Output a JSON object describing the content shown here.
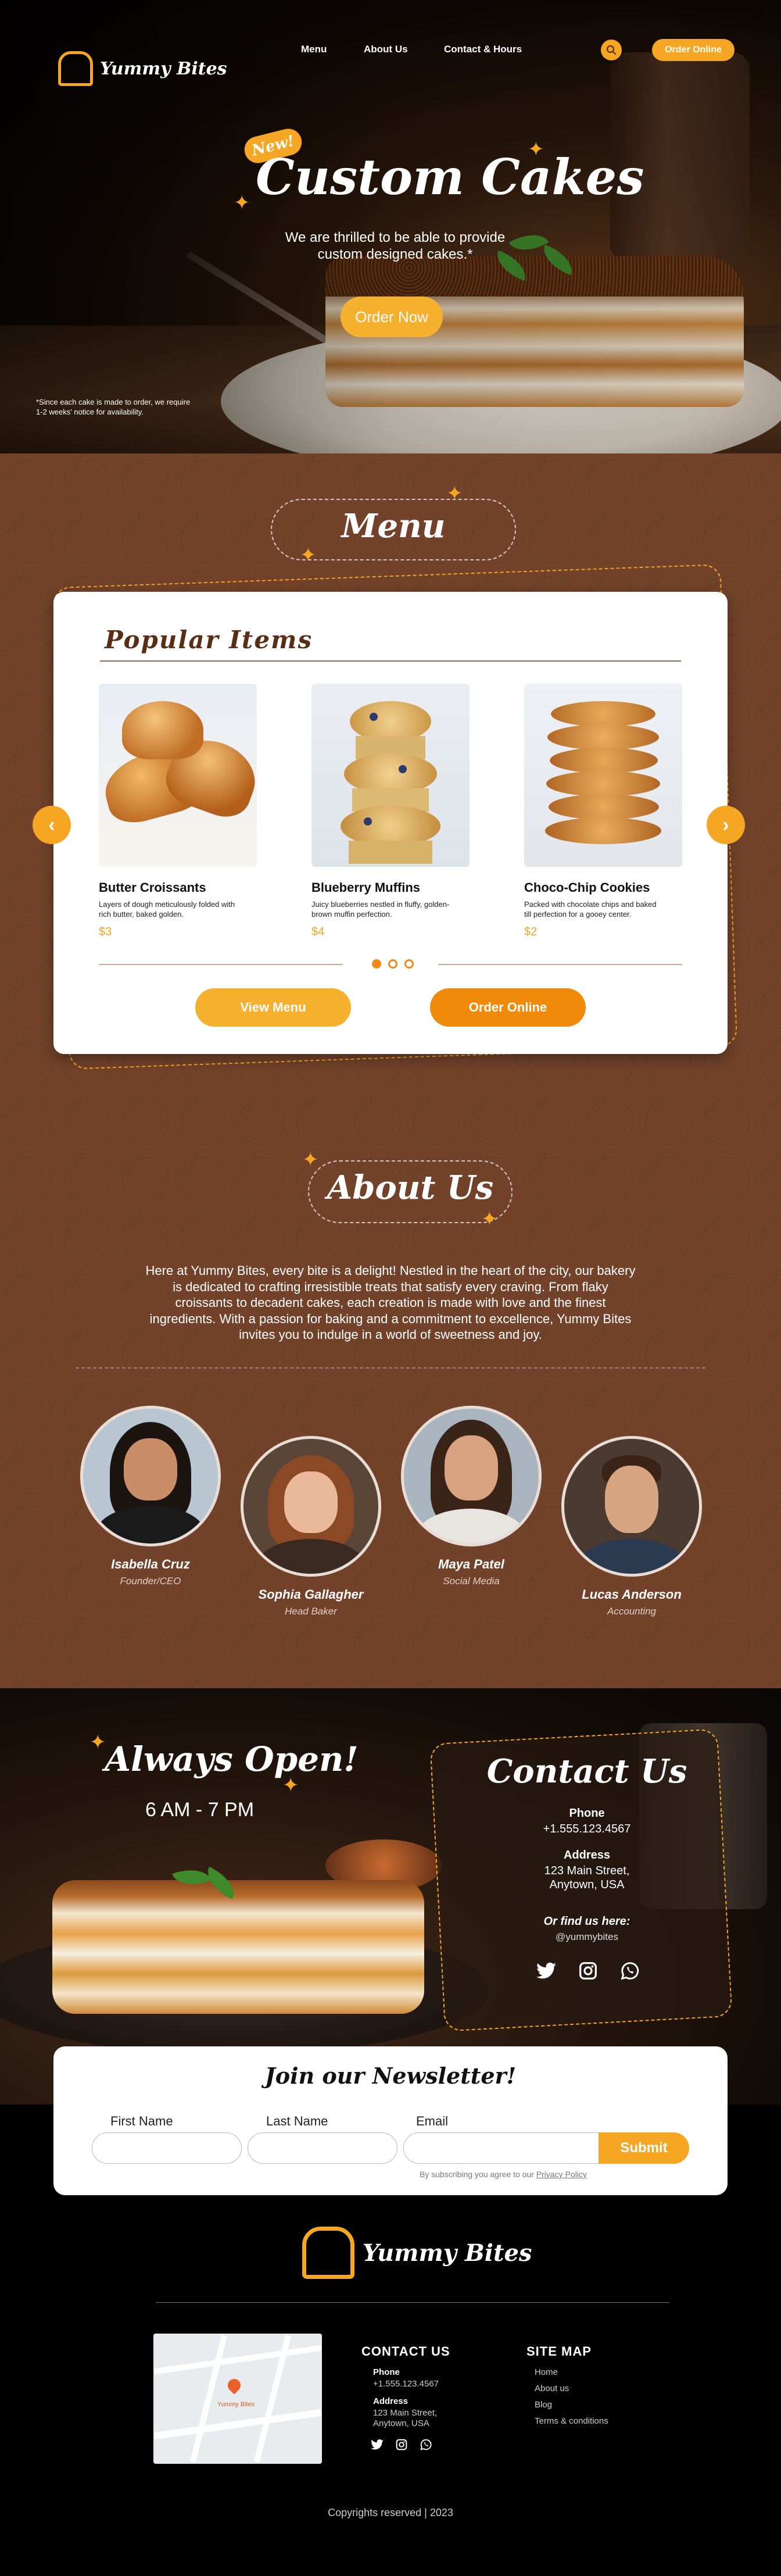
{
  "brand": {
    "name": "Yummy Bites",
    "accent": "#f5a623",
    "brown": "#72422a"
  },
  "nav": {
    "items": [
      "Menu",
      "About Us",
      "Contact & Hours"
    ],
    "order_online": "Order Online"
  },
  "hero": {
    "badge": "New!",
    "title": "Custom Cakes",
    "subtitle": "We are thrilled to be able to provide custom designed cakes.*",
    "cta": "Order Now",
    "note": "*Since each cake is made to order, we require 1-2 weeks' notice for availability."
  },
  "menu": {
    "title": "Menu",
    "card_title": "Popular Items",
    "items": [
      {
        "name": "Butter Croissants",
        "desc": "Layers of dough meticulously folded with rich butter, baked golden.",
        "price": "$3",
        "image": "croissants"
      },
      {
        "name": "Blueberry Muffins",
        "desc": "Juicy blueberries nestled in fluffy, golden-brown muffin perfection.",
        "price": "$4",
        "image": "blueberry-muffins"
      },
      {
        "name": "Choco-Chip Cookies",
        "desc": "Packed with chocolate chips and baked till perfection for a gooey center.",
        "price": "$2",
        "image": "chocolate-chip-cookies"
      }
    ],
    "view_menu": "View Menu",
    "order_online": "Order Online",
    "active_slide": 1
  },
  "about": {
    "title": "About Us",
    "text": "Here at Yummy Bites, every bite is a delight! Nestled in the heart of the city, our bakery is dedicated to crafting irresistible treats that satisfy every craving. From flaky croissants to decadent cakes, each creation is made with love and the finest ingredients. With a passion for baking and a commitment to excellence, Yummy Bites invites you to indulge in a world of sweetness and joy.",
    "team": [
      {
        "name": "Isabella Cruz",
        "role": "Founder/CEO"
      },
      {
        "name": "Sophia Gallagher",
        "role": "Head Baker"
      },
      {
        "name": "Maya Patel",
        "role": "Social Media"
      },
      {
        "name": "Lucas Anderson",
        "role": "Accounting"
      }
    ]
  },
  "hours": {
    "title": "Always Open!",
    "time": "6 AM - 7 PM"
  },
  "contact": {
    "title": "Contact Us",
    "phone_label": "Phone",
    "phone": "+1.555.123.4567",
    "address_label": "Address",
    "address_line1": "123 Main Street,",
    "address_line2": "Anytown, USA",
    "find_label": "Or find us here:",
    "handle": "@yummybites"
  },
  "newsletter": {
    "title": "Join our Newsletter!",
    "first_name": "First Name",
    "last_name": "Last Name",
    "email": "Email",
    "submit": "Submit",
    "note_prefix": "By subscribing you agree to our ",
    "privacy": "Privacy Policy"
  },
  "footer": {
    "contact_title": "CONTACT US",
    "phone_label": "Phone",
    "phone": "+1.555.123.4567",
    "address_label": "Address",
    "address_line1": "123 Main Street,",
    "address_line2": "Anytown, USA",
    "sitemap_title": "SITE MAP",
    "links": [
      "Home",
      "About us",
      "Blog",
      "Terms & conditions"
    ],
    "map_labels": [
      "Yummy Bites"
    ],
    "copyright": "Copyrights reserved | 2023"
  }
}
